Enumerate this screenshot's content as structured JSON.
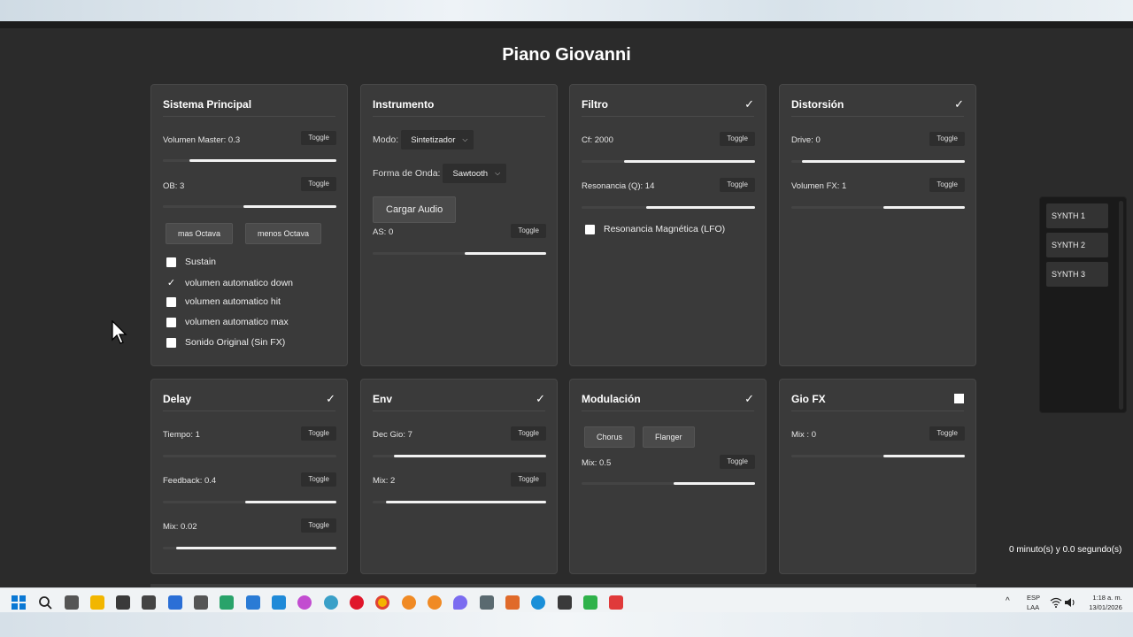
{
  "app": {
    "title": "Piano Giovanni",
    "timer": "0 minuto(s) y 0.0 segundo(s)"
  },
  "cards": {
    "principal": {
      "title": "Sistema Principal",
      "vol_label": "Volumen Master: 0.3",
      "ob_label": "OB: 3",
      "toggle": "Toggle",
      "vol_value": 0.3,
      "ob_value": 3,
      "octave_up": "mas Octava",
      "octave_down": "menos Octava",
      "checks": [
        {
          "label": "Sustain",
          "checked": false
        },
        {
          "label": "volumen automatico down",
          "checked": true
        },
        {
          "label": "volumen automatico hit",
          "checked": false
        },
        {
          "label": "volumen automatico max",
          "checked": false
        },
        {
          "label": "Sonido Original (Sin FX)",
          "checked": false
        }
      ]
    },
    "instrumento": {
      "title": "Instrumento",
      "modo_label": "Modo:",
      "modo_value": "Sintetizador",
      "onda_label": "Forma de Onda:",
      "onda_value": "Sawtooth",
      "load": "Cargar Audio",
      "as_label": "AS: 0",
      "toggle": "Toggle"
    },
    "filtro": {
      "title": "Filtro",
      "check": "✓",
      "cf_label": "Cf: 2000",
      "q_label": "Resonancia (Q): 14",
      "lfo_label": "Resonancia Magnética (LFO)",
      "toggle": "Toggle"
    },
    "distorsion": {
      "title": "Distorsión",
      "check": "✓",
      "drive_label": "Drive: 0",
      "fx_label": "Volumen FX: 1",
      "toggle": "Toggle"
    },
    "delay": {
      "title": "Delay",
      "check": "✓",
      "tiempo_label": "Tiempo: 1",
      "feedback_label": "Feedback: 0.4",
      "mix_label": "Mix: 0.02",
      "toggle": "Toggle"
    },
    "env": {
      "title": "Env",
      "check": "✓",
      "dec_label": "Dec Gio: 7",
      "mix_label": "Mix: 2",
      "toggle": "Toggle"
    },
    "modulacion": {
      "title": "Modulación",
      "check": "✓",
      "chorus": "Chorus",
      "flanger": "Flanger",
      "mix_label": "Mix: 0.5",
      "toggle": "Toggle"
    },
    "giofx": {
      "title": "Gio FX",
      "mix_label": "Mix : 0",
      "toggle": "Toggle"
    }
  },
  "synths": [
    "SYNTH 1",
    "SYNTH 2",
    "SYNTH 3"
  ],
  "taskbar": {
    "lang_top": "ESP",
    "lang_bottom": "LAA",
    "time": "1:18 a. m.",
    "date": "13/01/2026",
    "tray_chevron": "^"
  },
  "colors": {
    "panel": "#3a3a3a",
    "background": "#2b2b2b",
    "slider_fill": "#f2f2f2",
    "accent_blue": "#0a78d4"
  }
}
